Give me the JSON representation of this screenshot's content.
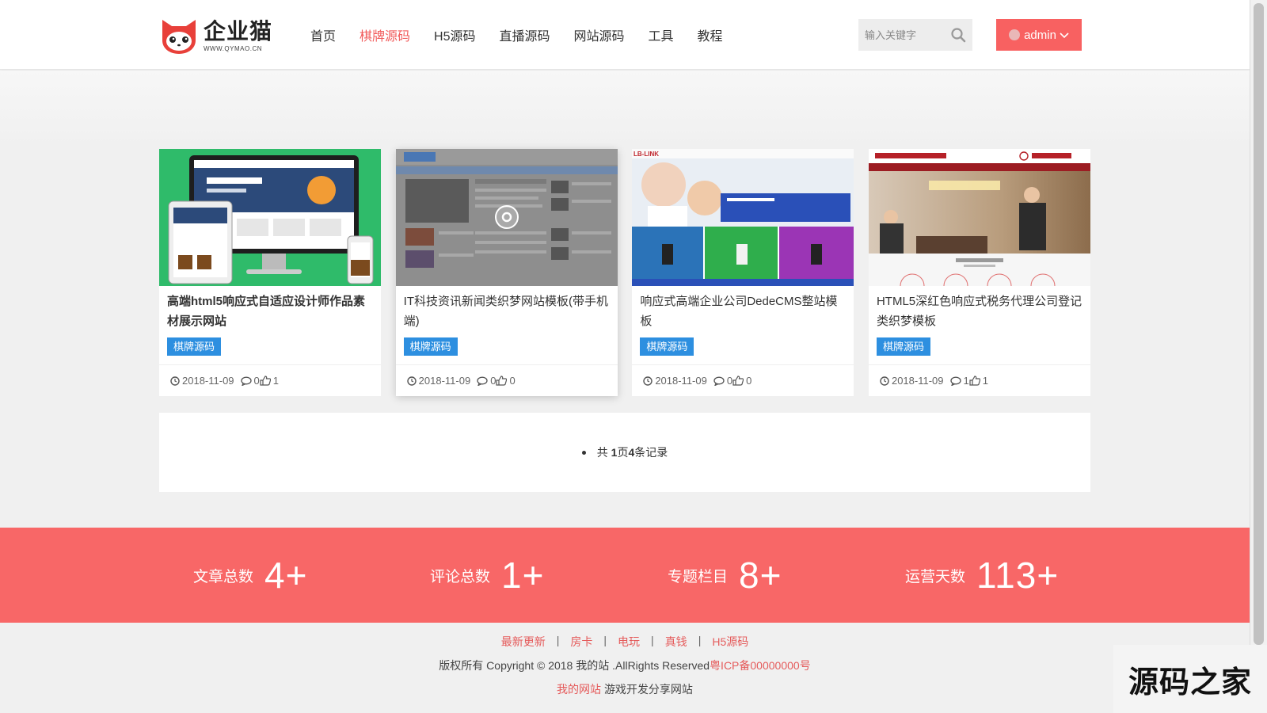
{
  "header": {
    "logo_name": "企业猫",
    "logo_sub": "WWW.QYMAO.CN",
    "nav": [
      {
        "label": "首页",
        "active": false
      },
      {
        "label": "棋牌源码",
        "active": true
      },
      {
        "label": "H5源码",
        "active": false
      },
      {
        "label": "直播源码",
        "active": false
      },
      {
        "label": "网站源码",
        "active": false
      },
      {
        "label": "工具",
        "active": false
      },
      {
        "label": "教程",
        "active": false
      }
    ],
    "search_placeholder": "输入关键字",
    "user_label": "admin"
  },
  "cards": [
    {
      "title": "高端html5响应式自适应设计师作品素材展示网站",
      "tag": "棋牌源码",
      "date": "2018-11-09",
      "comments": "0",
      "likes": "1"
    },
    {
      "title": "IT科技资讯新闻类织梦网站模板(带手机端)",
      "tag": "棋牌源码",
      "date": "2018-11-09",
      "comments": "0",
      "likes": "0"
    },
    {
      "title": "响应式高端企业公司DedeCMS整站模板",
      "tag": "棋牌源码",
      "date": "2018-11-09",
      "comments": "0",
      "likes": "0"
    },
    {
      "title": "HTML5深红色响应式税务代理公司登记类织梦模板",
      "tag": "棋牌源码",
      "date": "2018-11-09",
      "comments": "1",
      "likes": "1"
    }
  ],
  "pager": {
    "prefix": "共",
    "pages": "1",
    "pages_unit": "页",
    "records": "4",
    "records_unit": "条记录"
  },
  "stats": [
    {
      "label": "文章总数",
      "value": "4+"
    },
    {
      "label": "评论总数",
      "value": "1+"
    },
    {
      "label": "专题栏目",
      "value": "8+"
    },
    {
      "label": "运营天数",
      "value": "113+"
    }
  ],
  "footer": {
    "links": [
      "最新更新",
      "房卡",
      "电玩",
      "真钱",
      "H5源码"
    ],
    "copyright": "版权所有 Copyright © 2018 我的站 .AllRights Reserved",
    "icp": "粤ICP备00000000号",
    "site_name": "我的网站",
    "site_desc": "游戏开发分享网站"
  },
  "watermark": "源码之家",
  "colors": {
    "accent": "#f86161",
    "tag_blue": "#2d8fe0",
    "stats_bg": "#f86767"
  }
}
